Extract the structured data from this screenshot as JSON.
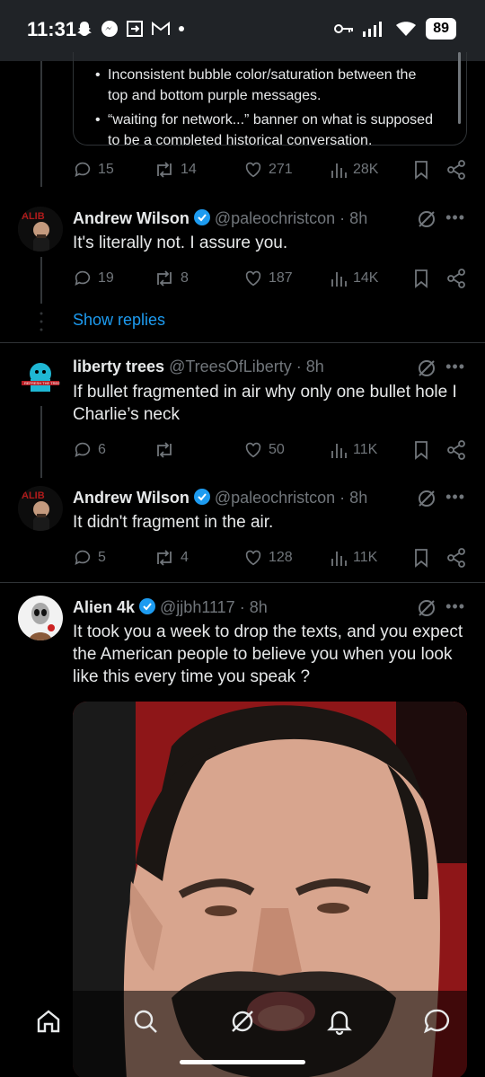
{
  "status_bar": {
    "time": "11:31",
    "battery": "89"
  },
  "quoted_fragment": {
    "bullets": [
      "Inconsistent bubble color/saturation between the top and bottom purple messages.",
      "“waiting for network...” banner on what is supposed to be a completed historical conversation."
    ]
  },
  "tweets": [
    {
      "stats": {
        "replies": "15",
        "reposts": "14",
        "likes": "271",
        "views": "28K"
      }
    },
    {
      "name": "Andrew Wilson",
      "handle": "@paleochristcon · 8h",
      "text": "It's literally not. I assure you.",
      "stats": {
        "replies": "19",
        "reposts": "8",
        "likes": "187",
        "views": "14K"
      }
    },
    {
      "name": "liberty trees",
      "handle": "@TreesOfLiberty · 8h",
      "text": "If bullet fragmented in air why only one bullet hole I Charlie’s neck",
      "stats": {
        "replies": "6",
        "reposts": "",
        "likes": "50",
        "views": "11K"
      }
    },
    {
      "name": "Andrew Wilson",
      "handle": "@paleochristcon · 8h",
      "text": "It didn't fragment in the air.",
      "stats": {
        "replies": "5",
        "reposts": "4",
        "likes": "128",
        "views": "11K"
      }
    },
    {
      "name": "Alien 4k",
      "handle": "@jjbh1117 · 8h",
      "text": "It took you a week to drop the texts, and you expect the American people to believe you when you look like this every time you speak ?",
      "stats": {}
    }
  ],
  "show_replies": "Show replies",
  "colors": {
    "accent": "#1d9bf0",
    "muted": "#71767b",
    "text": "#e7e9ea",
    "divider": "#2f3336"
  }
}
